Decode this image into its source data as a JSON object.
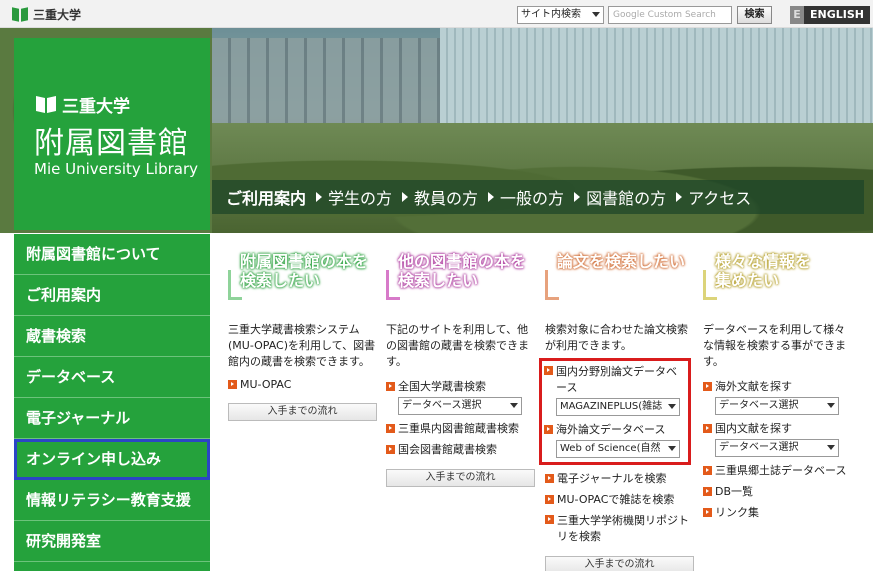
{
  "topbar": {
    "brand": "三重大学",
    "scope_select": "サイト内検索",
    "search_placeholder": "Google Custom Search",
    "search_button": "検索",
    "lang_e": "E",
    "lang_english": "ENGLISH"
  },
  "logo": {
    "university": "三重大学",
    "library": "附属図書館",
    "english": "Mie University Library"
  },
  "nav": [
    {
      "label": "ご利用案内",
      "current": true
    },
    {
      "label": "学生の方"
    },
    {
      "label": "教員の方"
    },
    {
      "label": "一般の方"
    },
    {
      "label": "図書館の方"
    },
    {
      "label": "アクセス"
    }
  ],
  "sidebar": {
    "items": [
      {
        "label": "附属図書館について"
      },
      {
        "label": "ご利用案内"
      },
      {
        "label": "蔵書検索"
      },
      {
        "label": "データベース"
      },
      {
        "label": "電子ジャーナル"
      },
      {
        "label": "オンライン申し込み"
      },
      {
        "label": "情報リテラシー教育支援"
      },
      {
        "label": "研究開発室"
      }
    ]
  },
  "columns": {
    "c1": {
      "title1": "附属図書館の本を",
      "title2": "検索したい",
      "desc": "三重大学蔵書検索システム(MU-OPAC)を利用して、図書館内の蔵書を検索できます。",
      "link1": "MU-OPAC",
      "flow": "入手までの流れ",
      "color": "#8fd39a"
    },
    "c2": {
      "title1": "他の図書館の本を",
      "title2": "検索したい",
      "desc": "下記のサイトを利用して、他の図書館の蔵書を検索できます。",
      "link1": "全国大学蔵書検索",
      "select1": "データベース選択",
      "link2": "三重県内図書館蔵書検索",
      "link3": "国会図書館蔵書検索",
      "flow": "入手までの流れ",
      "color": "#d77ac9"
    },
    "c3": {
      "title1": "論文を検索したい",
      "desc": "検索対象に合わせた論文検索が利用できます。",
      "link1": "国内分野別論文データベース",
      "select1": "MAGAZINEPLUS(雑誌",
      "link2": "海外論文データベース",
      "select2": "Web of Science(自然",
      "link3": "電子ジャーナルを検索",
      "link4": "MU-OPACで雑誌を検索",
      "link5": "三重大学学術機関リポジトリを検索",
      "flow": "入手までの流れ",
      "color": "#e7a27d"
    },
    "c4": {
      "title1": "様々な情報を",
      "title2": "集めたい",
      "desc": "データベースを利用して様々な情報を検索する事ができます。",
      "link1": "海外文献を探す",
      "select1": "データベース選択",
      "link2": "国内文献を探す",
      "select2": "データベース選択",
      "link3": "三重県郷土誌データベース",
      "link4": "DB一覧",
      "link5": "リンク集",
      "color": "#dcd47a"
    }
  }
}
